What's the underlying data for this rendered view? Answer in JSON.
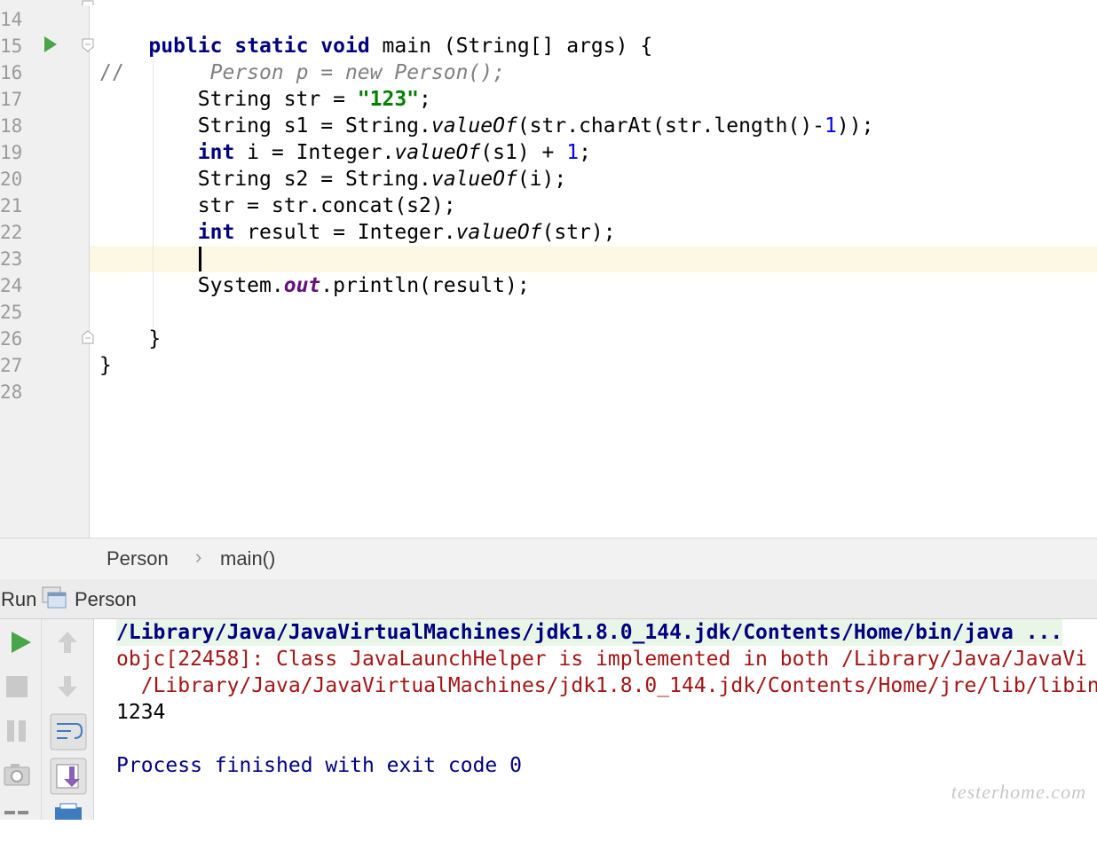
{
  "editor": {
    "line_numbers": [
      "14",
      "15",
      "16",
      "17",
      "18",
      "19",
      "20",
      "21",
      "22",
      "23",
      "24",
      "25",
      "26",
      "27",
      "28"
    ],
    "line15": {
      "kw1": "public",
      "kw2": "static",
      "kw3": "void",
      "rest": " main (String[] args) {"
    },
    "line16": {
      "slashes": "//",
      "comment": "Person p = new Person();"
    },
    "line17": {
      "pre": "String str = ",
      "str": "\"123\"",
      "post": ";"
    },
    "line18": {
      "pre": "String s1 = String.",
      "it": "valueOf",
      "mid": "(str.charAt(str.length()-",
      "num": "1",
      "post": "));"
    },
    "line19": {
      "kw": "int",
      "pre": " i = Integer.",
      "it": "valueOf",
      "mid": "(s1) + ",
      "num": "1",
      "post": ";"
    },
    "line20": {
      "pre": "String s2 = String.",
      "it": "valueOf",
      "post": "(i);"
    },
    "line21": {
      "text": "str = str.concat(s2);"
    },
    "line22": {
      "kw": "int",
      "pre": " result = Integer.",
      "it": "valueOf",
      "post": "(str);"
    },
    "line24": {
      "pre": "System.",
      "field": "out",
      "post": ".println(result);"
    },
    "line26": {
      "text": "}"
    },
    "line27": {
      "text": "}"
    }
  },
  "breadcrumb": {
    "class": "Person",
    "separator": "›",
    "method": "main()"
  },
  "run_header": {
    "label": "Run",
    "config": "Person"
  },
  "console": {
    "lines": [
      "/Library/Java/JavaVirtualMachines/jdk1.8.0_144.jdk/Contents/Home/bin/java ...",
      "objc[22458]: Class JavaLaunchHelper is implemented in both /Library/Java/JavaVi",
      "  /Library/Java/JavaVirtualMachines/jdk1.8.0_144.jdk/Contents/Home/jre/lib/libin",
      "1234",
      "",
      "Process finished with exit code 0"
    ]
  },
  "watermark": "testerhome.com",
  "colors": {
    "keyword": "#000080",
    "string": "#008000",
    "number": "#0000ff",
    "field": "#660e7a",
    "error": "#a31515",
    "run_green": "#4aa54a"
  },
  "icons": [
    "run-gutter-icon",
    "fold-icon",
    "run-icon",
    "stop-icon",
    "pause-icon",
    "camera-icon",
    "up-arrow-icon",
    "down-arrow-icon",
    "soft-wrap-icon",
    "scroll-to-end-icon",
    "print-icon",
    "run-window-icon"
  ]
}
